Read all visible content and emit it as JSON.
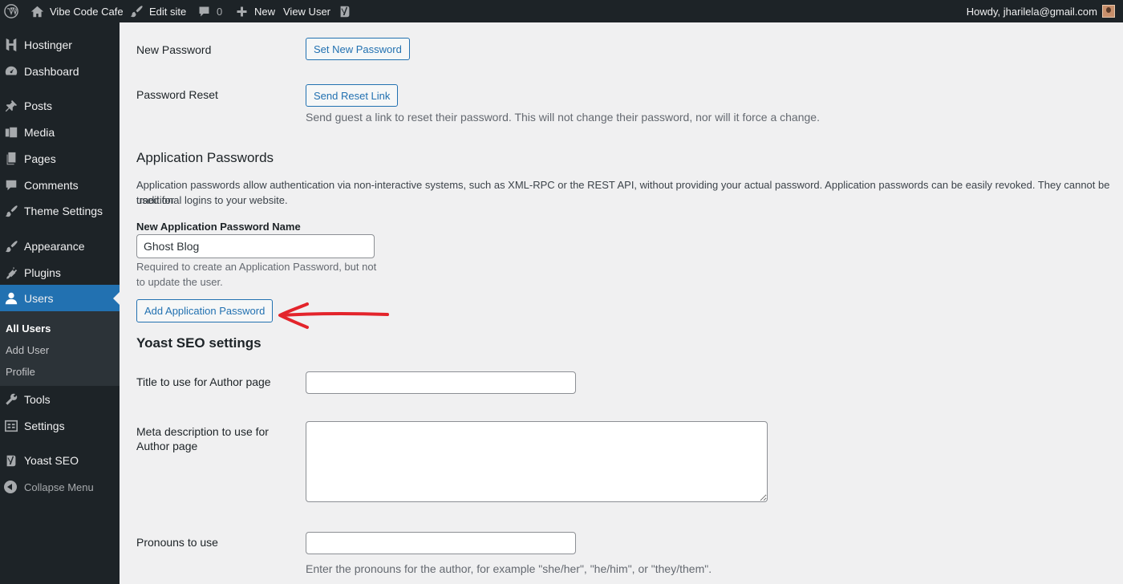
{
  "adminbar": {
    "site_name": "Vibe Code Cafe",
    "edit_site": "Edit site",
    "comments_count": "0",
    "new_label": "New",
    "view_user": "View User",
    "howdy": "Howdy, jharilela@gmail.com"
  },
  "sidebar": {
    "items": [
      {
        "label": "Hostinger",
        "icon": "hostinger-icon"
      },
      {
        "label": "Dashboard",
        "icon": "dashboard-icon"
      },
      {
        "label": "Posts",
        "icon": "pin-icon"
      },
      {
        "label": "Media",
        "icon": "media-icon"
      },
      {
        "label": "Pages",
        "icon": "pages-icon"
      },
      {
        "label": "Comments",
        "icon": "comment-icon"
      },
      {
        "label": "Theme Settings",
        "icon": "brush-icon"
      },
      {
        "label": "Appearance",
        "icon": "brush-icon"
      },
      {
        "label": "Plugins",
        "icon": "plug-icon"
      },
      {
        "label": "Users",
        "icon": "user-icon"
      },
      {
        "label": "Tools",
        "icon": "wrench-icon"
      },
      {
        "label": "Settings",
        "icon": "settings-icon"
      },
      {
        "label": "Yoast SEO",
        "icon": "yoast-icon"
      }
    ],
    "submenu": [
      "All Users",
      "Add User",
      "Profile"
    ],
    "collapse": "Collapse Menu"
  },
  "content": {
    "new_password_label": "New Password",
    "set_new_password_button": "Set New Password",
    "password_reset_label": "Password Reset",
    "send_reset_link_button": "Send Reset Link",
    "password_reset_desc": "Send guest a link to reset their password. This will not change their password, nor will it force a change.",
    "app_passwords_heading": "Application Passwords",
    "app_passwords_desc_line1": "Application passwords allow authentication via non-interactive systems, such as XML-RPC or the REST API, without providing your actual password. Application passwords can be easily revoked. They cannot be used for",
    "app_passwords_desc_line2": "traditional logins to your website.",
    "new_app_password_name_label": "New Application Password Name",
    "new_app_password_name_value": "Ghost Blog",
    "app_password_hint_line1": "Required to create an Application Password, but not",
    "app_password_hint_line2": "to update the user.",
    "add_app_password_button": "Add Application Password",
    "yoast_heading": "Yoast SEO settings",
    "title_author_label": "Title to use for Author page",
    "meta_desc_label_line1": "Meta description to use for",
    "meta_desc_label_line2": "Author page",
    "pronouns_label": "Pronouns to use",
    "pronouns_desc": "Enter the pronouns for the author, for example \"she/her\", \"he/him\", or \"they/them\"."
  },
  "colors": {
    "accent": "#2271b1",
    "admin_bg": "#1d2327",
    "annotation_arrow": "#e3242b"
  }
}
